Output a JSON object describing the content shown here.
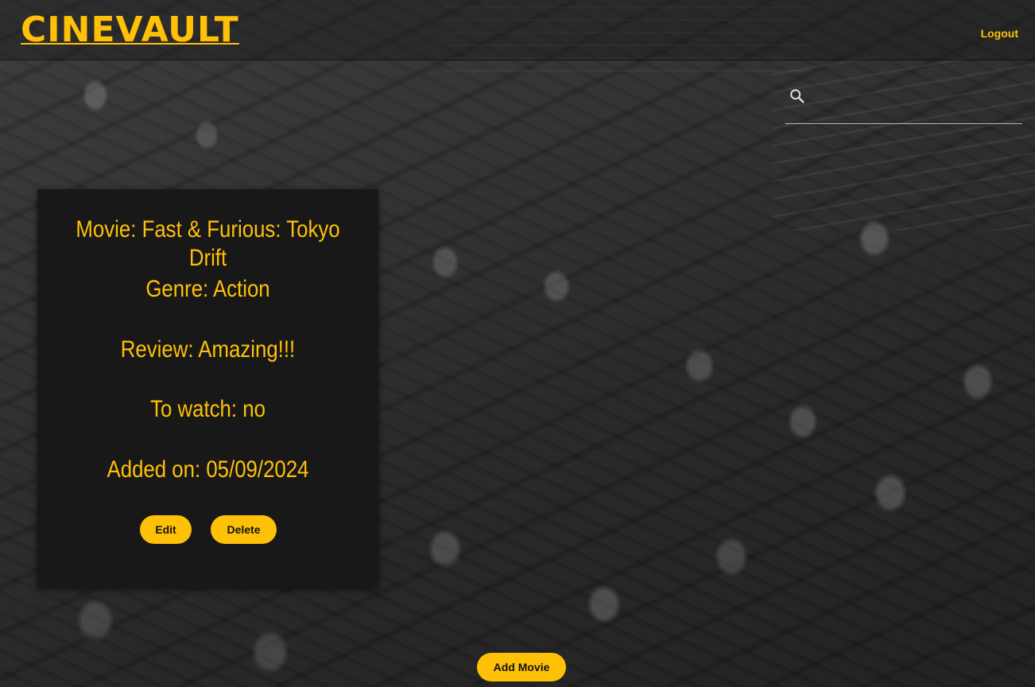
{
  "header": {
    "logo": "CINEVAULT",
    "logout_label": "Logout"
  },
  "search": {
    "icon": "search-icon",
    "value": "",
    "placeholder": ""
  },
  "movie_card": {
    "movie": "Movie: Fast & Furious: Tokyo Drift",
    "genre": "Genre: Action",
    "review": "Review: Amazing!!!",
    "to_watch": "To watch: no",
    "added_on": "Added on: 05/09/2024",
    "edit_label": "Edit",
    "delete_label": "Delete"
  },
  "actions": {
    "add_movie_label": "Add Movie"
  },
  "colors": {
    "accent": "#ffc107",
    "card_background": "#181818",
    "button_text": "#111111"
  }
}
